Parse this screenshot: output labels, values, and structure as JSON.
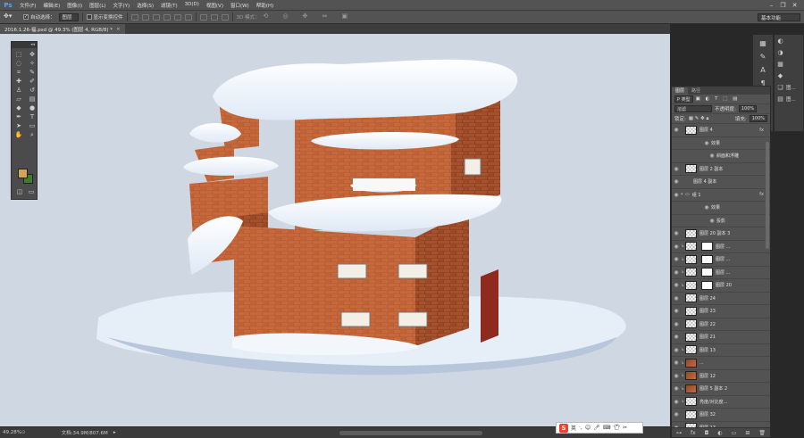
{
  "app": {
    "logo": "Ps"
  },
  "menu": [
    "文件(F)",
    "编辑(E)",
    "图像(I)",
    "图层(L)",
    "文字(Y)",
    "选择(S)",
    "滤镜(T)",
    "3D(D)",
    "视图(V)",
    "窗口(W)",
    "帮助(H)"
  ],
  "options": {
    "auto_select_label": "自动选择：",
    "auto_select_value": "图层",
    "show_transform_label": "显示变换控件",
    "mode_3d_label": "3D 模式：",
    "workspace": "基本功能"
  },
  "document": {
    "tab_title": "2016.1.26-福.psd @ 49.3% (图层 4, RGB/8) *"
  },
  "status": {
    "zoom": "49.28%",
    "doc_size": "文档:34.9M/807.6M"
  },
  "panel_strip": {
    "items": [
      "图...",
      "图..."
    ]
  },
  "layers_panel": {
    "tabs": [
      "图层",
      "路径"
    ],
    "kind_label": "P 类型",
    "blend_mode": "溶滤",
    "opacity_label": "不透明度:",
    "opacity_value": "100%",
    "lock_label": "锁定:",
    "fill_label": "填充:",
    "fill_value": "100%",
    "layers": [
      {
        "name": "图层 4",
        "fx": "fx",
        "selected": false
      },
      {
        "name": "效果",
        "fx": "",
        "selected": false
      },
      {
        "name": "斜面和浮雕",
        "fx": "",
        "selected": false
      },
      {
        "name": "图层 2 副本",
        "fx": "",
        "selected": false
      },
      {
        "name": "图层 4 副本",
        "fx": "",
        "selected": false
      },
      {
        "name": "组 1",
        "fx": "fx",
        "selected": false
      },
      {
        "name": "效果",
        "fx": "",
        "selected": false
      },
      {
        "name": "投影",
        "fx": "",
        "selected": false
      },
      {
        "name": "图层 20 副本 3",
        "fx": "",
        "selected": false
      },
      {
        "name": "图层 ...",
        "fx": "",
        "selected": false
      },
      {
        "name": "图层 ...",
        "fx": "",
        "selected": false
      },
      {
        "name": "图层 ...",
        "fx": "",
        "selected": false
      },
      {
        "name": "图层 20",
        "fx": "",
        "selected": false
      },
      {
        "name": "图层 24",
        "fx": "",
        "selected": false
      },
      {
        "name": "图层 23",
        "fx": "",
        "selected": false
      },
      {
        "name": "图层 22",
        "fx": "",
        "selected": false
      },
      {
        "name": "图层 21",
        "fx": "",
        "selected": false
      },
      {
        "name": "图层 13",
        "fx": "",
        "selected": false
      },
      {
        "name": "...",
        "fx": "",
        "selected": false
      },
      {
        "name": "图层 12",
        "fx": "",
        "selected": false
      },
      {
        "name": "图层 5 副本 2",
        "fx": "",
        "selected": false
      },
      {
        "name": "亮度/对比度...",
        "fx": "",
        "selected": false
      },
      {
        "name": "图层 32",
        "fx": "",
        "selected": false
      },
      {
        "name": "图层 17",
        "fx": "",
        "selected": false
      }
    ]
  },
  "ime": {
    "logo": "S",
    "lang": "英"
  },
  "colors": {
    "foreground": "#d6a35c",
    "background": "#3f7a2e",
    "canvas_bg": "#cfd7e2",
    "selection": "#6a7b94"
  }
}
